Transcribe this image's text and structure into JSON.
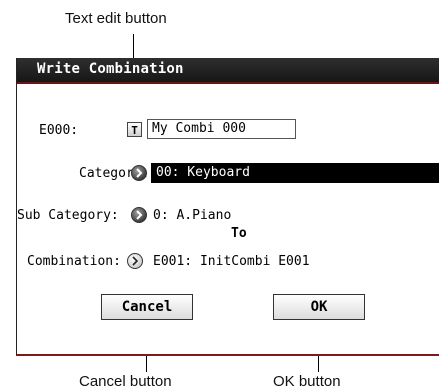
{
  "callouts": {
    "text_edit": "Text edit button",
    "cancel": "Cancel button",
    "ok": "OK button"
  },
  "dialog": {
    "title": "Write Combination",
    "bank_label": "E000:",
    "text_edit_glyph": "T",
    "name_value": "My Combi 000",
    "category_label": "Category:",
    "category_value": "00: Keyboard",
    "subcategory_label": "Sub Category:",
    "subcategory_value": "0: A.Piano",
    "to_label": "To",
    "combination_label": "Combination:",
    "combination_value": "E001: InitCombi E001",
    "cancel_label": "Cancel",
    "ok_label": "OK"
  },
  "icons": {
    "text_edit": "text-edit-icon",
    "popup_arrow": "popup-arrow-icon"
  },
  "colors": {
    "titlebar": "#1f1f1f",
    "accent": "#7a1c1c",
    "selected_field": "#000000"
  }
}
